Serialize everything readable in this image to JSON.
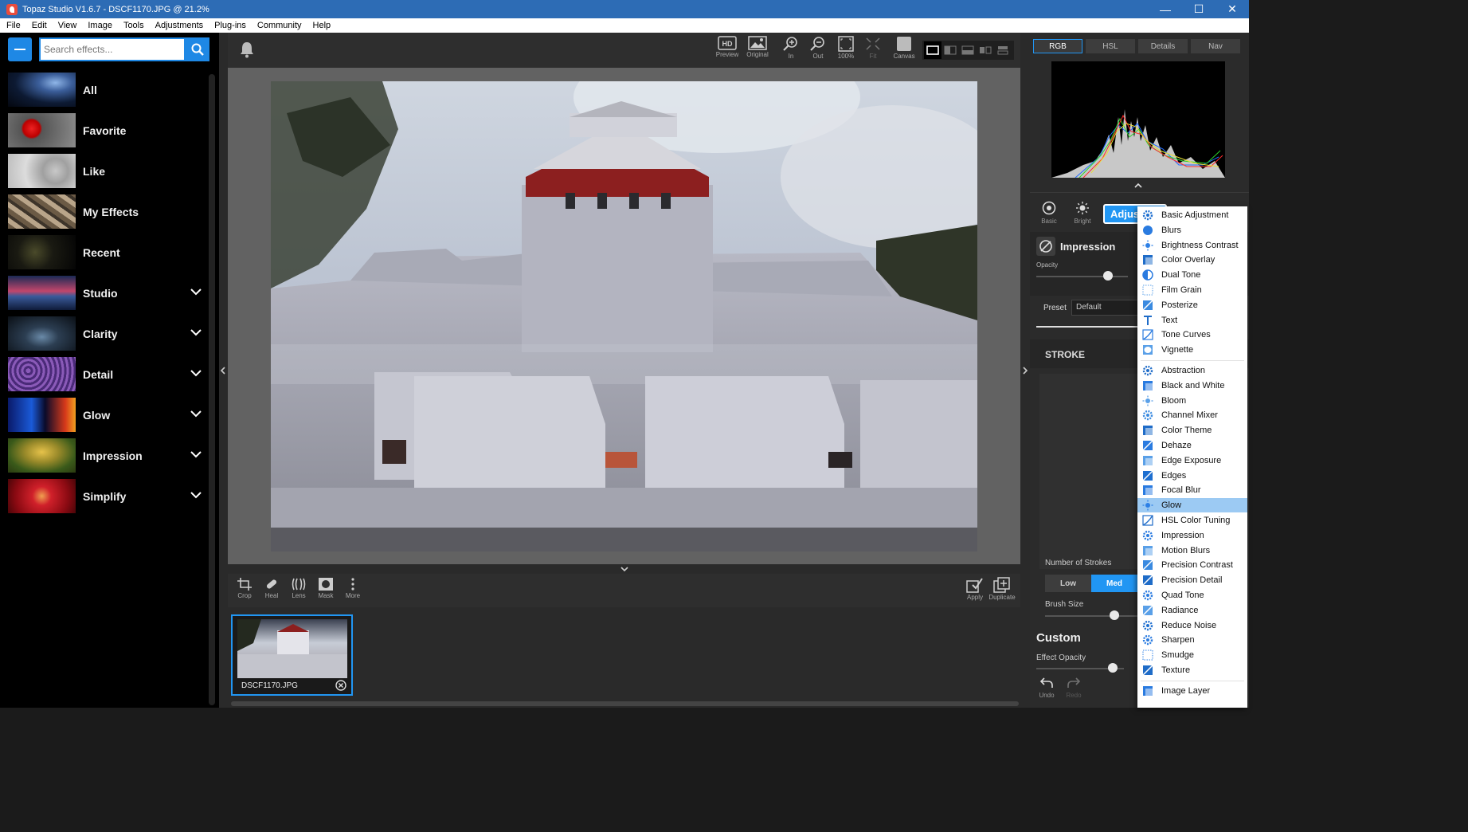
{
  "titlebar": {
    "title": "Topaz Studio V1.6.7 - DSCF1170.JPG @ 21.2%",
    "minimize": "—",
    "maximize": "☐",
    "close": "✕"
  },
  "menubar": [
    "File",
    "Edit",
    "View",
    "Image",
    "Tools",
    "Adjustments",
    "Plug-ins",
    "Community",
    "Help"
  ],
  "sidebar": {
    "search_placeholder": "Search effects...",
    "categories": [
      {
        "label": "All",
        "has_submenu": false
      },
      {
        "label": "Favorite",
        "has_submenu": false
      },
      {
        "label": "Like",
        "has_submenu": false
      },
      {
        "label": "My Effects",
        "has_submenu": false
      },
      {
        "label": "Recent",
        "has_submenu": false
      },
      {
        "label": "Studio",
        "has_submenu": true
      },
      {
        "label": "Clarity",
        "has_submenu": true
      },
      {
        "label": "Detail",
        "has_submenu": true
      },
      {
        "label": "Glow",
        "has_submenu": true
      },
      {
        "label": "Impression",
        "has_submenu": true
      },
      {
        "label": "Simplify",
        "has_submenu": true
      }
    ]
  },
  "top_toolbar": {
    "preview": "Preview",
    "original": "Original",
    "zoom_in": "In",
    "zoom_out": "Out",
    "zoom_100": "100%",
    "fit": "Fit",
    "canvas": "Canvas",
    "hd_badge": "HD"
  },
  "bottom_toolbar": {
    "crop": "Crop",
    "heal": "Heal",
    "lens": "Lens",
    "mask": "Mask",
    "more": "More",
    "apply": "Apply",
    "duplicate": "Duplicate"
  },
  "filmstrip": {
    "filename": "DSCF1170.JPG"
  },
  "right_panel": {
    "hist_tabs": [
      "RGB",
      "HSL",
      "Details",
      "Nav"
    ],
    "active_hist_tab": "RGB",
    "basic": "Basic",
    "bright": "Bright",
    "adjust_button": "Adjustments",
    "effect_name": "Impression",
    "opacity_label": "Opacity",
    "opacity_value": 0.92,
    "preset_label": "Preset",
    "preset_value": "Default",
    "stroke_section": "STROKE",
    "number_of_strokes_label": "Number of Strokes",
    "strokes_options": [
      "Low",
      "Med"
    ],
    "strokes_selected": "Med",
    "brush_size_label": "Brush Size",
    "brush_size_value": 0.9,
    "custom_label": "Custom",
    "effect_opacity_label": "Effect Opacity",
    "effect_opacity_value": 0.95,
    "undo": "Undo",
    "redo": "Redo"
  },
  "adjust_menu": {
    "group1": [
      "Basic Adjustment",
      "Blurs",
      "Brightness Contrast",
      "Color Overlay",
      "Dual Tone",
      "Film Grain",
      "Posterize",
      "Text",
      "Tone Curves",
      "Vignette"
    ],
    "group2": [
      "Abstraction",
      "Black and White",
      "Bloom",
      "Channel Mixer",
      "Color Theme",
      "Dehaze",
      "Edge Exposure",
      "Edges",
      "Focal Blur",
      "Glow",
      "HSL Color Tuning",
      "Impression",
      "Motion Blurs",
      "Precision Contrast",
      "Precision Detail",
      "Quad Tone",
      "Radiance",
      "Reduce Noise",
      "Sharpen",
      "Smudge",
      "Texture"
    ],
    "group3": [
      "Image Layer"
    ],
    "highlighted": "Glow"
  },
  "colors": {
    "accent": "#2196f3",
    "titlebar": "#2d6cb5",
    "menu_highlight": "#9ccaf3"
  }
}
